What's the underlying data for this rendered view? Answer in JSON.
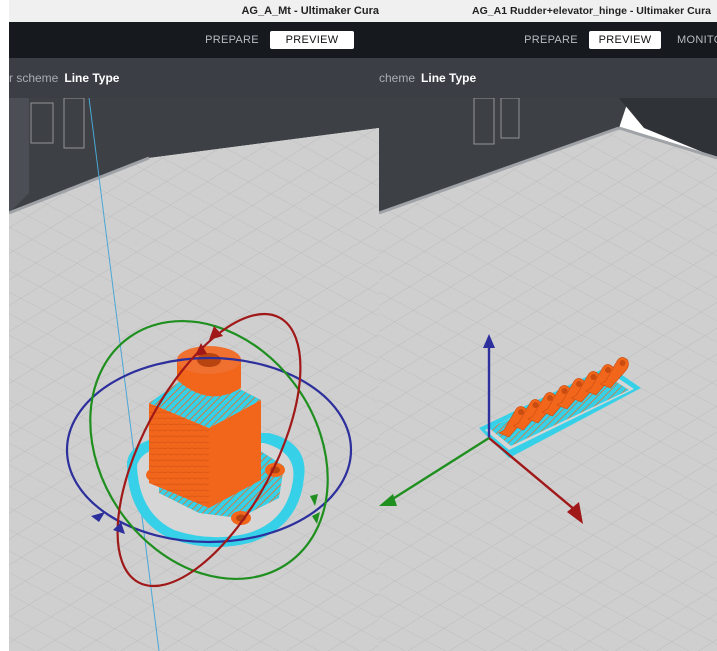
{
  "left_window": {
    "title": "AG_A_Mt - Ultimaker Cura",
    "tabs": [
      {
        "label": "PREPARE",
        "active": false
      },
      {
        "label": "PREVIEW",
        "active": true
      }
    ],
    "color_scheme_label": "r scheme",
    "color_scheme_value": "Line Type"
  },
  "right_window": {
    "title": "AG_A1 Rudder+elevator_hinge - Ultimaker Cura",
    "tabs": [
      {
        "label": "PREPARE",
        "active": false
      },
      {
        "label": "PREVIEW",
        "active": true
      },
      {
        "label": "MONITO",
        "active": false
      }
    ],
    "color_scheme_label": "cheme",
    "color_scheme_value": "Line Type"
  },
  "colors": {
    "model": "#f2661c",
    "model_dark": "#c94c10",
    "skin": "#36d1e8",
    "build_plate": "#cfcfcf",
    "grid": "#b9b9b9",
    "toolbar": "#16191d",
    "scheme_bar": "#3b3f45",
    "axis_x": "#a01818",
    "axis_y": "#1f8f1f",
    "axis_z": "#2c2f9c"
  }
}
